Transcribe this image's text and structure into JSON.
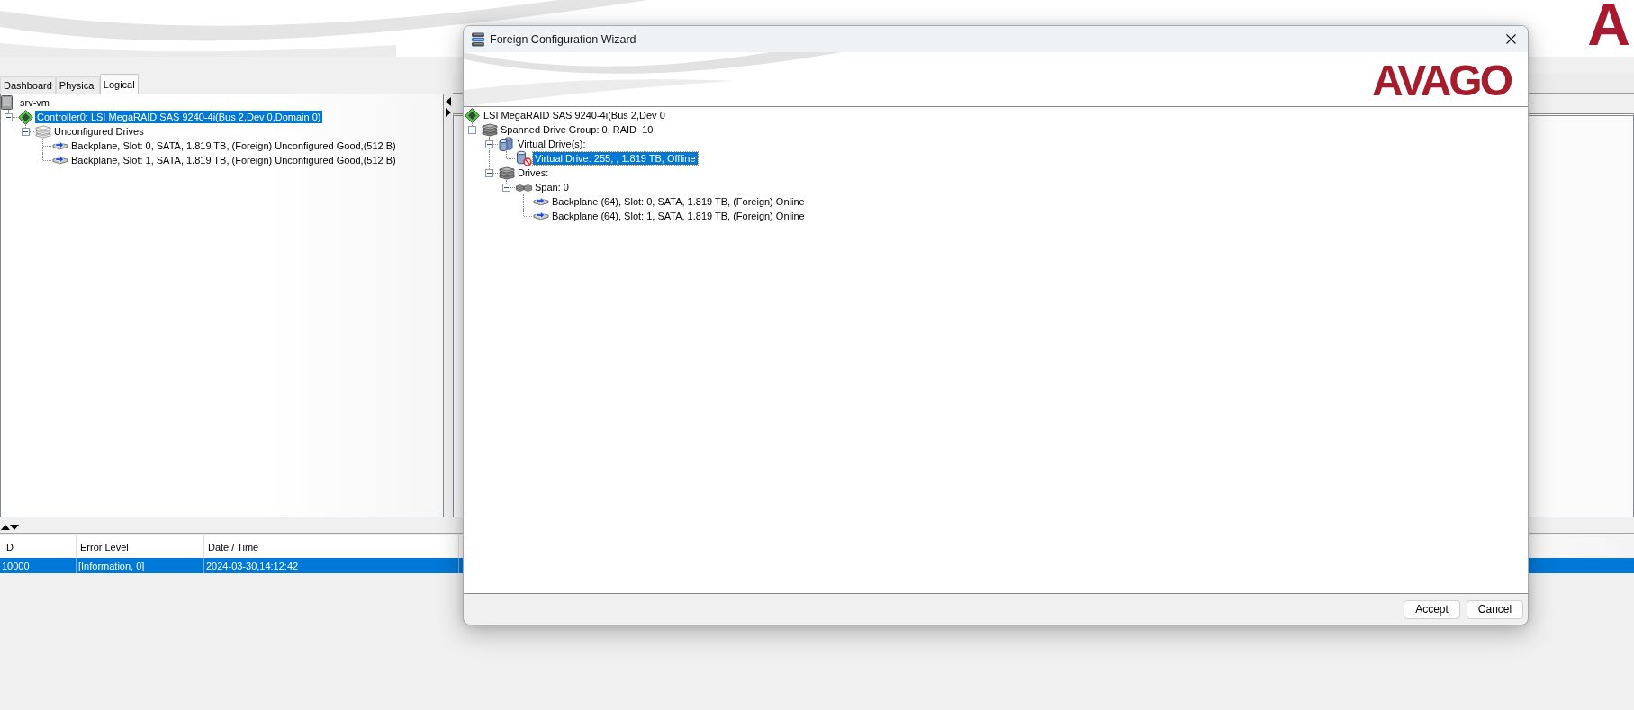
{
  "header": {
    "logo": "A"
  },
  "tabs": [
    {
      "label": "Dashboard",
      "selected": false
    },
    {
      "label": "Physical",
      "selected": false
    },
    {
      "label": "Logical",
      "selected": true
    }
  ],
  "tree": [
    {
      "label": "srv-vm",
      "kind": "server",
      "selected": false,
      "children": [
        {
          "label": "Controller0: LSI MegaRAID SAS 9240-4i(Bus 2,Dev 0,Domain 0)",
          "kind": "controller",
          "selected": true,
          "expanded": true,
          "children": [
            {
              "label": "Unconfigured Drives",
              "kind": "unconfigured",
              "selected": false,
              "expanded": true,
              "children": [
                {
                  "label": "Backplane, Slot: 0, SATA, 1.819 TB, (Foreign) Unconfigured Good,(512 B)",
                  "kind": "disk",
                  "selected": false
                },
                {
                  "label": "Backplane, Slot: 1, SATA, 1.819 TB, (Foreign) Unconfigured Good,(512 B)",
                  "kind": "disk",
                  "selected": false
                }
              ]
            }
          ]
        }
      ]
    }
  ],
  "log": {
    "columns": [
      "ID",
      "Error Level",
      "Date / Time"
    ],
    "rows": [
      {
        "selected": true,
        "cells": [
          "10000",
          "[Information, 0]",
          "2024-03-30,14:12:42"
        ]
      }
    ]
  },
  "dialog": {
    "title": "Foreign Configuration Wizard",
    "logo": "AVAGO",
    "tree": {
      "focused": true,
      "nodes": [
        {
          "label": "LSI MegaRAID SAS 9240-4i(Bus 2,Dev 0",
          "kind": "controller",
          "selected": false,
          "children": [
            {
              "label": "Spanned Drive Group: 0, RAID  10",
              "kind": "spanned",
              "selected": false,
              "expanded": true,
              "children": [
                {
                  "label": "Virtual Drive(s):",
                  "kind": "vdgroup",
                  "selected": false,
                  "expanded": true,
                  "children": [
                    {
                      "label": "Virtual Drive: 255, , 1.819 TB, Offline",
                      "kind": "vdoffline",
                      "selected": true
                    }
                  ]
                },
                {
                  "label": "Drives:",
                  "kind": "drives",
                  "selected": false,
                  "expanded": true,
                  "children": [
                    {
                      "label": "Span: 0",
                      "kind": "span",
                      "selected": false,
                      "expanded": true,
                      "children": [
                        {
                          "label": "Backplane (64), Slot: 0, SATA, 1.819 TB, (Foreign) Online",
                          "kind": "disk",
                          "selected": false
                        },
                        {
                          "label": "Backplane (64), Slot: 1, SATA, 1.819 TB, (Foreign) Online",
                          "kind": "disk",
                          "selected": false
                        }
                      ]
                    }
                  ]
                }
              ]
            }
          ]
        }
      ]
    },
    "buttons": [
      "Accept",
      "Cancel"
    ]
  }
}
